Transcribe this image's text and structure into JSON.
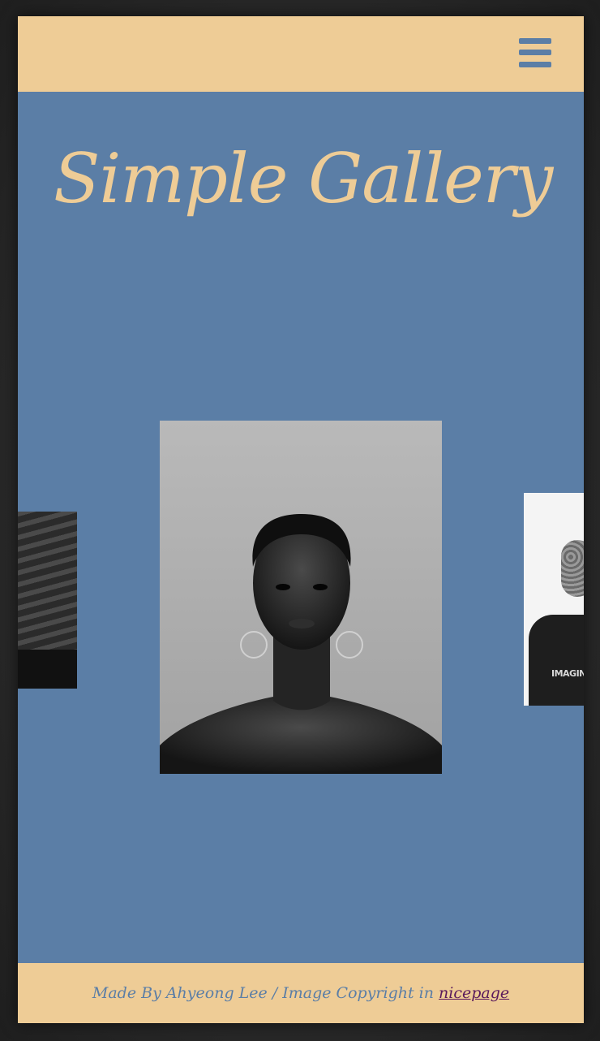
{
  "header": {
    "menu_icon": "hamburger-icon"
  },
  "hero": {
    "title": "Simple Gallery"
  },
  "gallery": {
    "slides": [
      {
        "position": "left",
        "description": "architecture-photo"
      },
      {
        "position": "center",
        "description": "portrait-photo"
      },
      {
        "position": "right",
        "description": "portrait-photo"
      }
    ]
  },
  "footer": {
    "credit_text": "Made By Ahyeong Lee / Image Copyright in ",
    "link_text": "nicepage"
  },
  "colors": {
    "accent": "#eecc96",
    "background": "#5b7ea6",
    "link": "#5a1a5c"
  }
}
